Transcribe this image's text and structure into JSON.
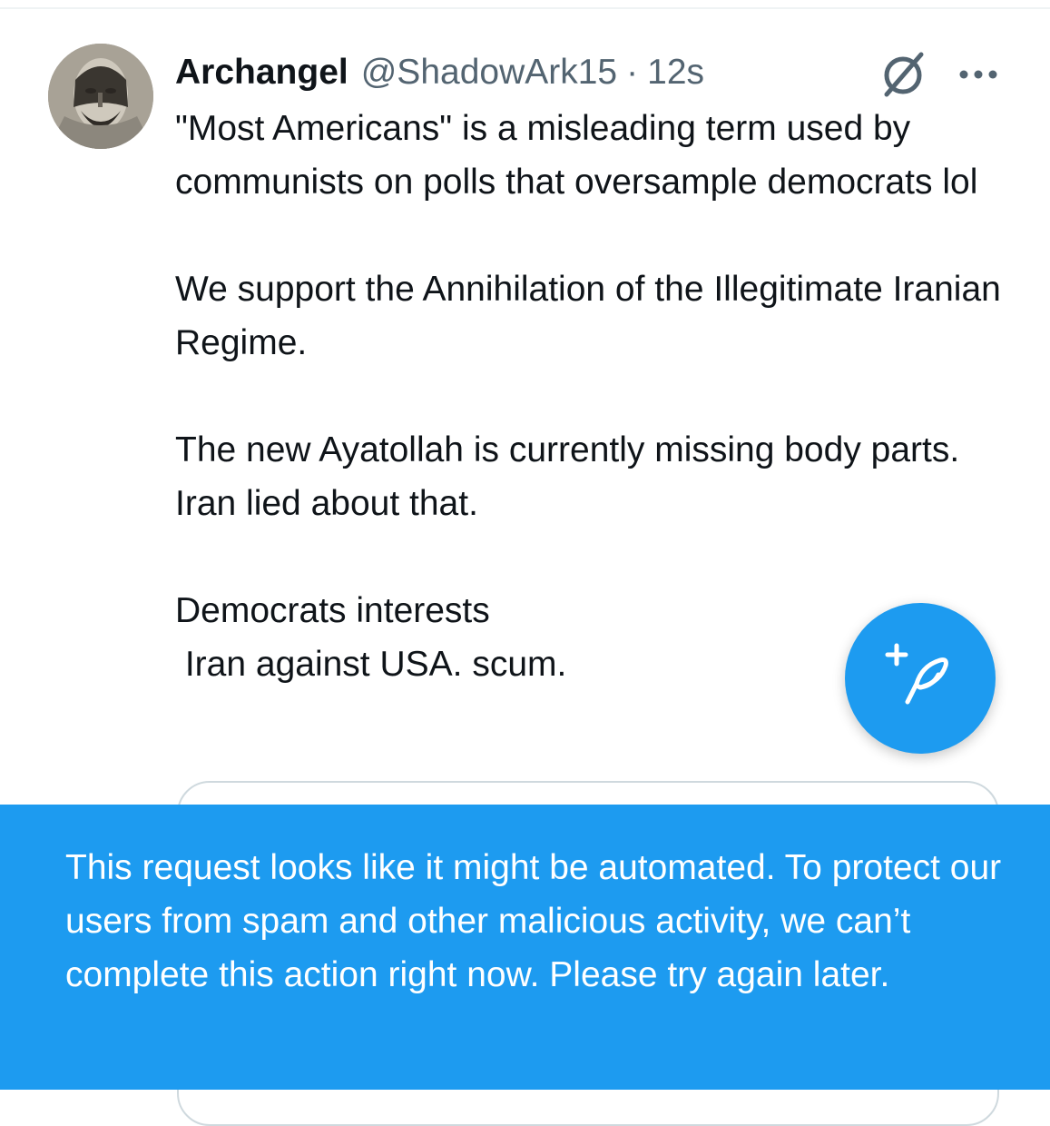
{
  "tweet": {
    "author": {
      "display_name": "Archangel",
      "handle": "@ShadowArk15"
    },
    "separator": "·",
    "timestamp": "12s",
    "body": "\"Most Americans\" is a misleading term used by communists on polls that oversample democrats lol\n\nWe support the Annihilation of the Illegitimate Iranian Regime.\n\nThe new Ayatollah is currently missing body parts. Iran lied about that.\n\nDemocrats interests\n Iran against USA. scum.",
    "icons": {
      "grok": "grok-icon",
      "more": "more-icon"
    }
  },
  "compose_button": {
    "icon": "compose-feather-plus-icon"
  },
  "toast": {
    "message": "This request looks like it might be automated. To protect our users from spam and other malicious activity, we can’t complete this action right now. Please try again later."
  },
  "colors": {
    "accent": "#1d9bf0",
    "text_primary": "#0f1419",
    "text_secondary": "#536471",
    "border": "#cfd9de",
    "background": "#ffffff"
  }
}
